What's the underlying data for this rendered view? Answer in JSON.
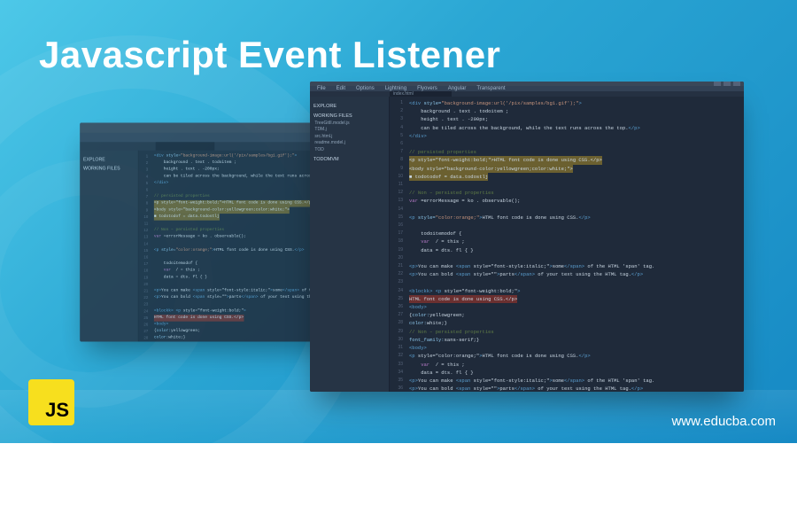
{
  "title": "Javascript Event Listener",
  "url": "www.educba.com",
  "logo_text": "JS",
  "menu": [
    "File",
    "Edit",
    "Options",
    "Lightning",
    "Flyovers",
    "Angular",
    "Transparent"
  ],
  "tab_name": "index.html",
  "sidebar": {
    "header": "EXPLORE",
    "working": "WORKING FILES",
    "files": [
      "TreeGitII.model.js",
      "TDM.j",
      "src.html.j",
      "readme.model.j",
      "TOD"
    ],
    "project": "TODOMVM"
  },
  "code_lines": [
    {
      "n": 1,
      "html": "<span class='c-tag'>&lt;div</span> <span class='c-attr'>style=</span><span class='c-string'>\"background-image:url('/pix/samples/bg1.gif');\"</span><span class='c-tag'>&gt;</span>"
    },
    {
      "n": 2,
      "html": "    background . text . todoitem ;"
    },
    {
      "n": 3,
      "html": "    height . text . -200px;"
    },
    {
      "n": 4,
      "html": "    can be tiled across the background, while the text runs across the top.<span class='c-tag'>&lt;/p&gt;</span>"
    },
    {
      "n": 5,
      "html": "<span class='c-tag'>&lt;/div&gt;</span>"
    },
    {
      "n": 6,
      "html": ""
    },
    {
      "n": 7,
      "html": "<span class='c-comment'>// persisted properties</span>"
    },
    {
      "n": 8,
      "html": "<span class='hl-warn'>&lt;p style=\"font-weight:bold;\"&gt;HTML font code is done using CSS.&lt;/p&gt;</span>"
    },
    {
      "n": 9,
      "html": "<span class='hl-warn'>&lt;body style=\"background-color:yellowgreen;color:white;\"&gt;</span>"
    },
    {
      "n": 10,
      "html": "<span class='hl-warn'>&#9632; todotodof = data.todostlj</span>"
    },
    {
      "n": 11,
      "html": ""
    },
    {
      "n": 12,
      "html": "<span class='c-comment'>// Non – persisted properties</span>"
    },
    {
      "n": 13,
      "html": "<span class='c-keyword'>var</span> =errorMessage = ko . observable();"
    },
    {
      "n": 14,
      "html": ""
    },
    {
      "n": 15,
      "html": "<span class='c-tag'>&lt;p</span> <span class='c-attr'>style=</span><span class='c-string'>\"color:orange;\"</span><span class='c-tag'>&gt;</span>HTML font code is done using CSS.<span class='c-tag'>&lt;/p&gt;</span>"
    },
    {
      "n": 16,
      "html": ""
    },
    {
      "n": 17,
      "html": "    todoitemodof {"
    },
    {
      "n": 18,
      "html": "    <span class='c-keyword'>var</span>  / = this ;"
    },
    {
      "n": 19,
      "html": "    data = dts. fl { }"
    },
    {
      "n": 20,
      "html": ""
    },
    {
      "n": 21,
      "html": "<span class='c-tag'>&lt;p&gt;</span>You can make <span class='c-tag'>&lt;span</span> style=\"font-style:italic;\"<span class='c-tag'>&gt;</span>some<span class='c-tag'>&lt;/span&gt;</span> of the HTML 'span' tag."
    },
    {
      "n": 22,
      "html": "<span class='c-tag'>&lt;p&gt;</span>You can bold <span class='c-tag'>&lt;span</span> style=\"\"<span class='c-tag'>&gt;</span>parts<span class='c-tag'>&lt;/span&gt;</span> of your text using the HTML tag.<span class='c-tag'>&lt;/p&gt;</span>"
    },
    {
      "n": 23,
      "html": ""
    },
    {
      "n": 24,
      "html": "<span class='c-tag'>&lt;blockk&gt;</span> <span class='c-tag'>&lt;p</span> style=\"font-weight:bold;\"<span class='c-tag'>&gt;</span>"
    },
    {
      "n": 25,
      "html": "<span class='hl-err'>HTML font code is done using CSS.&lt;/p&gt;</span>"
    },
    {
      "n": 26,
      "html": "<span class='c-tag'>&lt;body&gt;</span>"
    },
    {
      "n": 27,
      "html": "{<span class='c-attr'>color:</span>yellowgreen;"
    },
    {
      "n": 28,
      "html": "<span class='c-attr'>color:</span>white;}"
    },
    {
      "n": 29,
      "html": "<span class='c-comment'>// Non – persisted properties</span>"
    },
    {
      "n": 30,
      "html": "<span class='c-attr'>font_family:</span>sans-serif;}"
    },
    {
      "n": 31,
      "html": "<span class='c-tag'>&lt;body&gt;</span>"
    },
    {
      "n": 32,
      "html": "<span class='c-tag'>&lt;p</span> style=\"color:orange;\"<span class='c-tag'>&gt;</span>HTML font code is done using CSS.<span class='c-tag'>&lt;/p&gt;</span>"
    },
    {
      "n": 33,
      "html": "    <span class='c-keyword'>var</span>  / = this ;"
    },
    {
      "n": 34,
      "html": "    data = dts. fl { }"
    },
    {
      "n": 35,
      "html": "<span class='c-tag'>&lt;p&gt;</span>You can make <span class='c-tag'>&lt;span</span> style=\"font-style:italic;\"<span class='c-tag'>&gt;</span>some<span class='c-tag'>&lt;/span&gt;</span> of the HTML 'span' tag."
    },
    {
      "n": 36,
      "html": "<span class='c-tag'>&lt;p&gt;</span>You can bold <span class='c-tag'>&lt;span</span> style=\"\"<span class='c-tag'>&gt;</span>parts<span class='c-tag'>&lt;/span&gt;</span> of your text using the HTML tag.<span class='c-tag'>&lt;/p&gt;</span>"
    }
  ]
}
